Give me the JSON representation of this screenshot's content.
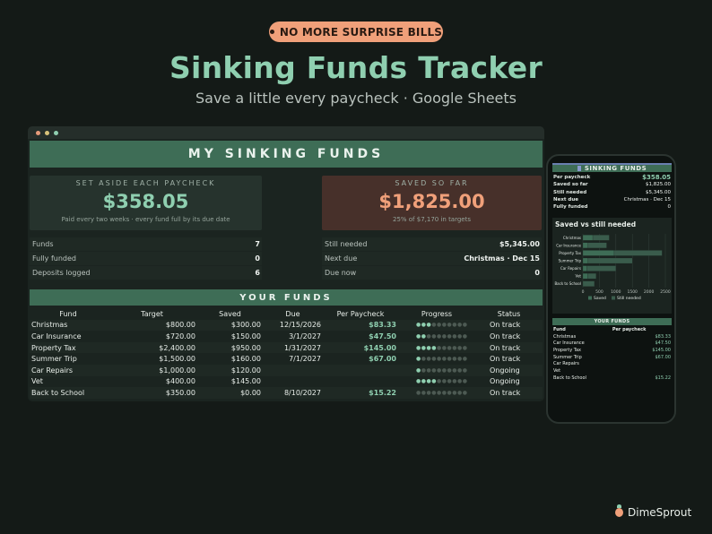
{
  "badge": "NO MORE SURPRISE BILLS",
  "title": "Sinking Funds Tracker",
  "subtitle": "Save a little every paycheck · Google Sheets",
  "colors": {
    "accent": "#8fcfb0",
    "coral": "#f0a07a",
    "header_green": "#3e6d56",
    "bg": "#141a17"
  },
  "desktop": {
    "header": "MY SINKING FUNDS",
    "kpi_left": {
      "label": "SET ASIDE EACH PAYCHECK",
      "value": "$358.05",
      "note": "Paid every two weeks · every fund full by its due date"
    },
    "kpi_right": {
      "label": "SAVED SO FAR",
      "value": "$1,825.00",
      "note": "25% of $7,170 in targets"
    },
    "stats_left": [
      {
        "k": "Funds",
        "v": "7"
      },
      {
        "k": "Fully funded",
        "v": "0"
      },
      {
        "k": "Deposits logged",
        "v": "6"
      }
    ],
    "stats_right": [
      {
        "k": "Still needed",
        "v": "$5,345.00"
      },
      {
        "k": "Next due",
        "v": "Christmas · Dec 15"
      },
      {
        "k": "Due now",
        "v": "0"
      }
    ],
    "funds_header": "YOUR FUNDS",
    "columns": [
      "Fund",
      "Target",
      "Saved",
      "Due",
      "Per Paycheck",
      "Progress",
      "Status"
    ],
    "rows": [
      {
        "fund": "Christmas",
        "target": "$800.00",
        "saved": "$300.00",
        "due": "12/15/2026",
        "pp": "$83.33",
        "progress": 3,
        "status": "On track"
      },
      {
        "fund": "Car Insurance",
        "target": "$720.00",
        "saved": "$150.00",
        "due": "3/1/2027",
        "pp": "$47.50",
        "progress": 2,
        "status": "On track"
      },
      {
        "fund": "Property Tax",
        "target": "$2,400.00",
        "saved": "$950.00",
        "due": "1/31/2027",
        "pp": "$145.00",
        "progress": 4,
        "status": "On track"
      },
      {
        "fund": "Summer Trip",
        "target": "$1,500.00",
        "saved": "$160.00",
        "due": "7/1/2027",
        "pp": "$67.00",
        "progress": 1,
        "status": "On track"
      },
      {
        "fund": "Car Repairs",
        "target": "$1,000.00",
        "saved": "$120.00",
        "due": "",
        "pp": "",
        "progress": 1,
        "status": "Ongoing"
      },
      {
        "fund": "Vet",
        "target": "$400.00",
        "saved": "$145.00",
        "due": "",
        "pp": "",
        "progress": 4,
        "status": "Ongoing"
      },
      {
        "fund": "Back to School",
        "target": "$350.00",
        "saved": "$0.00",
        "due": "8/10/2027",
        "pp": "$15.22",
        "progress": 0,
        "status": "On track"
      }
    ]
  },
  "phone": {
    "header": "SINKING FUNDS",
    "stats": [
      {
        "k": "Per paycheck",
        "v": "$358.05",
        "big": true
      },
      {
        "k": "Saved so far",
        "v": "$1,825.00"
      },
      {
        "k": "Still needed",
        "v": "$5,345.00"
      },
      {
        "k": "Next due",
        "v": "Christmas · Dec 15"
      },
      {
        "k": "Fully funded",
        "v": "0"
      }
    ],
    "chart_title": "Saved vs still needed",
    "funds_header": "YOUR FUNDS",
    "table_head": [
      "Fund",
      "Per paycheck"
    ],
    "table_rows": [
      {
        "k": "Christmas",
        "v": "$83.33"
      },
      {
        "k": "Car Insurance",
        "v": "$47.50"
      },
      {
        "k": "Property Tax",
        "v": "$145.00"
      },
      {
        "k": "Summer Trip",
        "v": "$67.00"
      },
      {
        "k": "Car Repairs",
        "v": ""
      },
      {
        "k": "Vet",
        "v": ""
      },
      {
        "k": "Back to School",
        "v": "$15.22"
      }
    ]
  },
  "chart_data": {
    "type": "bar",
    "orientation": "horizontal",
    "stacked": true,
    "title": "Saved vs still needed",
    "categories": [
      "Christmas",
      "Car Insurance",
      "Property Tax",
      "Summer Trip",
      "Car Repairs",
      "Vet",
      "Back to School"
    ],
    "series": [
      {
        "name": "Saved",
        "values": [
          300,
          150,
          950,
          160,
          120,
          145,
          0
        ],
        "color": "#3e6d56"
      },
      {
        "name": "Still needed",
        "values": [
          500,
          570,
          1450,
          1340,
          880,
          255,
          350
        ],
        "color": "#2b4a3c"
      }
    ],
    "x_ticks": [
      0,
      500,
      1000,
      1500,
      2000,
      2500
    ],
    "xlim": [
      0,
      2500
    ],
    "legend": "bottom"
  },
  "brand": "DimeSprout"
}
